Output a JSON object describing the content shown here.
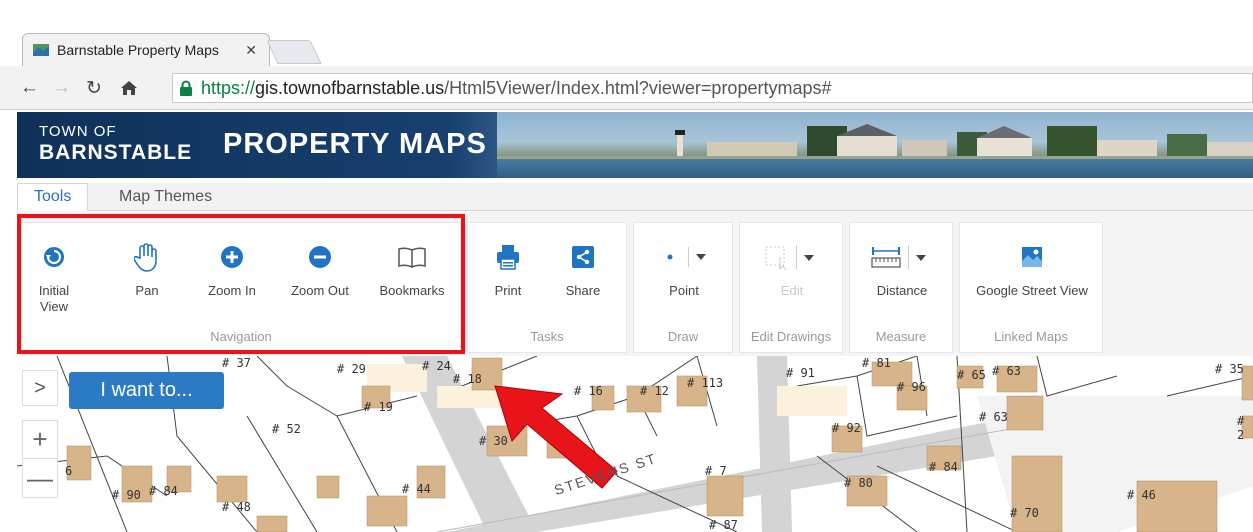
{
  "browser": {
    "tab_title": "Barnstable Property Maps",
    "tab_close": "✕",
    "url_scheme": "https://",
    "url_domain": "gis.townofbarnstable.us",
    "url_path": "/Html5Viewer/Index.html?viewer=propertymaps#"
  },
  "banner": {
    "town_of": "TOWN OF",
    "town_name": "BARNSTABLE",
    "title": "PROPERTY MAPS"
  },
  "tabs": [
    {
      "label": "Tools",
      "active": true
    },
    {
      "label": "Map Themes",
      "active": false
    }
  ],
  "ribbon": {
    "groups": [
      {
        "name": "Navigation",
        "tools": [
          "Initial View",
          "Pan",
          "Zoom In",
          "Zoom Out",
          "Bookmarks"
        ]
      },
      {
        "name": "Tasks",
        "tools": [
          "Print",
          "Share"
        ]
      },
      {
        "name": "Draw",
        "tools": [
          "Point"
        ]
      },
      {
        "name": "Edit Drawings",
        "tools": [
          "Edit"
        ]
      },
      {
        "name": "Measure",
        "tools": [
          "Distance"
        ]
      },
      {
        "name": "Linked Maps",
        "tools": [
          "Google Street View"
        ]
      }
    ]
  },
  "map": {
    "expand_label": ">",
    "i_want_to": "I want to...",
    "zoom_in": "+",
    "zoom_out": "—",
    "street_name": "STEVENS ST",
    "parcels": [
      "# 37",
      "# 29",
      "# 24",
      "# 18",
      "# 19",
      "# 16",
      "# 12",
      "# 113",
      "# 91",
      "# 81",
      "# 96",
      "# 65",
      "# 63",
      "# 35",
      "# 52",
      "# 30",
      "# 92",
      "# 63",
      "# 2",
      "6",
      "# 7",
      "# 84",
      "# 90",
      "# 84",
      "# 44",
      "# 48",
      "# 80",
      "# 46",
      "# 70",
      "# 87"
    ]
  },
  "colors": {
    "accent": "#2a7bc3",
    "highlight": "#e8141a",
    "building": "#d8b48a"
  }
}
